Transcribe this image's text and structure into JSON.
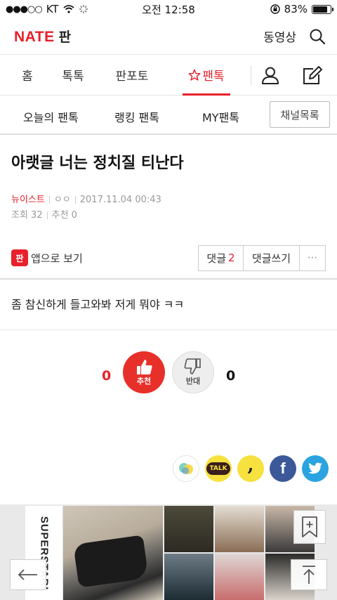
{
  "status": {
    "carrier": "KT",
    "time": "오전 12:58",
    "battery": "83%",
    "battery_level": 0.83
  },
  "header": {
    "logo": "NATE",
    "section": "판",
    "video_label": "동영상"
  },
  "tabs": [
    {
      "label": "홈"
    },
    {
      "label": "톡톡"
    },
    {
      "label": "판포토"
    },
    {
      "label": "팬톡"
    }
  ],
  "subtabs": {
    "items": [
      {
        "label": "오늘의 팬톡"
      },
      {
        "label": "랭킹 팬톡"
      },
      {
        "label": "MY팬톡"
      }
    ],
    "channel_button": "채널목록"
  },
  "article": {
    "title": "아랫글 너는 정치질 티난다",
    "category": "뉴이스트",
    "author": "ㅇㅇ",
    "date": "2017.11.04 00:43",
    "views_label": "조회 32",
    "recommend_label": "추천 0",
    "body": "좀 참신하게 들고와봐 저게 뭐야 ㅋㅋ"
  },
  "actions": {
    "app_badge": "판",
    "app_view": "앱으로 보기",
    "comment_label": "댓글",
    "comment_count": "2",
    "write_comment": "댓글쓰기",
    "more": "···"
  },
  "votes": {
    "up_count": "0",
    "up_label": "추천",
    "down_label": "반대",
    "down_count": "0"
  },
  "share": {
    "talk": "TALK",
    "comma": ",",
    "facebook": "f"
  },
  "ad": {
    "brand": "SUPERSTARI"
  },
  "colors": {
    "accent": "#e8202a",
    "facebook": "#3b5998",
    "twitter": "#2aa3e0",
    "kakao": "#f7e13f"
  }
}
